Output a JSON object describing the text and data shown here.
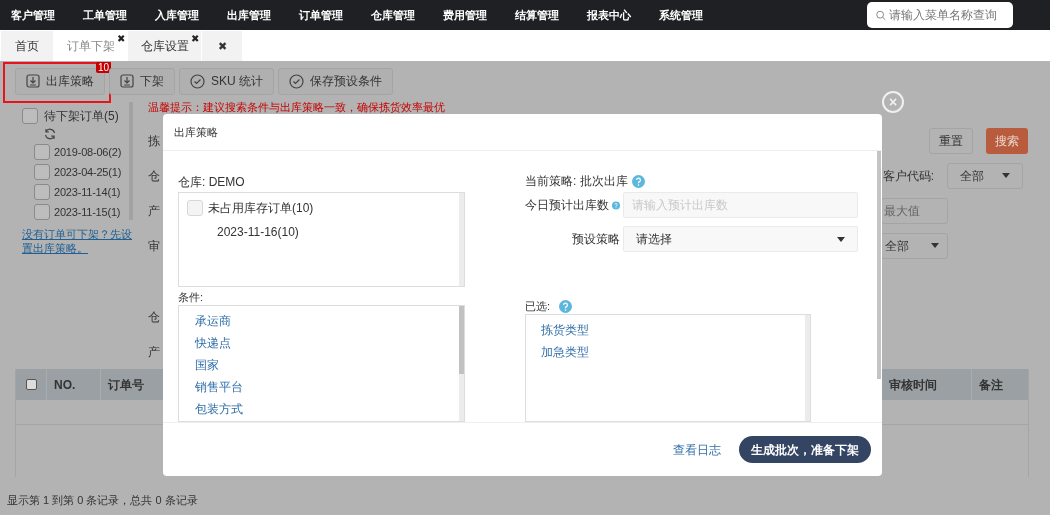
{
  "top_nav": {
    "menu": [
      "客户管理",
      "工单管理",
      "入库管理",
      "出库管理",
      "订单管理",
      "仓库管理",
      "费用管理",
      "结算管理",
      "报表中心",
      "系统管理"
    ],
    "search": {
      "placeholder": "请输入菜单名称查询"
    }
  },
  "tabs": [
    {
      "label": "首页",
      "selected": false
    },
    {
      "label": "订单下架",
      "selected": true,
      "close": "✖"
    },
    {
      "label": "仓库设置",
      "selected": false,
      "close": "✖"
    }
  ],
  "close_all_tab": "✖",
  "toolbar": [
    {
      "label": "出库策略",
      "highlighted": true,
      "badge": "10"
    },
    {
      "label": "下架",
      "highlighted": false
    },
    {
      "label": "SKU 统计",
      "highlighted": false
    },
    {
      "label": "保存预设条件",
      "highlighted": false
    }
  ],
  "order_tree": {
    "label": "待下架订单(5)",
    "checked": false,
    "children": [
      {
        "label": "2019-08-06(2)",
        "checked": false
      },
      {
        "label": "2023-04-25(1)",
        "checked": false
      },
      {
        "label": "2023-11-14(1)",
        "checked": false
      },
      {
        "label": "2023-11-15(1)",
        "checked": false
      }
    ]
  },
  "strategy_hint_link": "没有订单可下架？先设置出库策略。",
  "warning": "温馨提示：建议搜索条件与出库策略一致，确保拣货效率最优",
  "filter_labels": [
    "拣",
    "仓",
    "产",
    "审",
    "仓",
    "产"
  ],
  "filter_buttons": [
    {
      "label": "重置",
      "kind": "plain"
    },
    {
      "label": "搜索",
      "kind": "primary"
    }
  ],
  "customer_code": {
    "label": "客户代码:",
    "value": "全部"
  },
  "max_value": {
    "placeholder": "最大值"
  },
  "review_select": {
    "value": "全部"
  },
  "table": {
    "select_all": {
      "checked": false
    },
    "columns_left": [
      "NO.",
      "订单号"
    ],
    "columns_right": [
      "审核时间",
      "备注"
    ]
  },
  "status_bar": "显示第 1 到第 0 条记录，总共 0 条记录",
  "dialog": {
    "title": "出库策略",
    "close": "×",
    "warehouse": "仓库: DEMO",
    "order_tree": {
      "label": "未占用库存订单(10)",
      "checked": false,
      "children": [
        {
          "label": "2023-11-16(10)"
        }
      ]
    },
    "conditions_label": "条件:",
    "conditions": [
      "承运商",
      "快递点",
      "国家",
      "销售平台",
      "包装方式"
    ],
    "current_strategy": {
      "label": "当前策略:",
      "value": "批次出库"
    },
    "today_estimate": {
      "label": "今日预计出库数",
      "placeholder": "请输入预计出库数"
    },
    "preset_strategy": {
      "label": "预设策略",
      "value": "请选择"
    },
    "selected_label": "已选:",
    "selected": [
      "拣货类型",
      "加急类型"
    ],
    "log_link": "查看日志",
    "generate_button": "生成批次，准备下架"
  }
}
